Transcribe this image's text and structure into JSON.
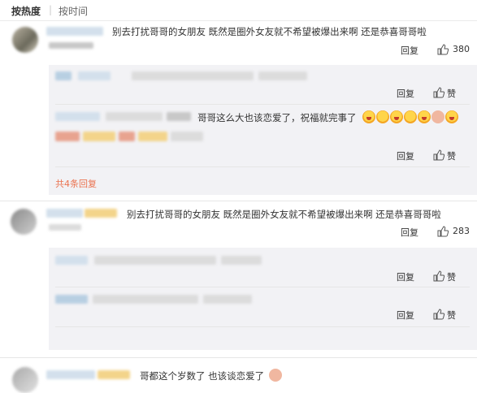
{
  "sort": {
    "hot_label": "按热度",
    "separator": "|",
    "time_label": "按时间"
  },
  "comments": [
    {
      "text": "别去打扰哥哥的女朋友 既然是圈外女友就不希望被爆出来啊 还是恭喜哥哥啦",
      "reply_label": "回复",
      "likes": "380",
      "replies": [
        {
          "reply_label": "回复",
          "like_label": "赞"
        },
        {
          "text": "哥哥这么大也该恋爱了，祝福就完事了",
          "reply_label": "回复",
          "like_label": "赞"
        }
      ],
      "more_replies": "共4条回复"
    },
    {
      "text": "别去打扰哥哥的女朋友 既然是圈外女友就不希望被爆出来啊 还是恭喜哥哥啦",
      "reply_label": "回复",
      "likes": "283",
      "replies": [
        {
          "reply_label": "回复",
          "like_label": "赞"
        },
        {
          "reply_label": "回复",
          "like_label": "赞"
        }
      ]
    },
    {
      "text": "哥都这个岁数了 也该谈恋爱了"
    }
  ],
  "colors": {
    "accent": "#eb7350",
    "reply_bg": "#f2f2f5",
    "text": "#333333"
  },
  "icons": {
    "like": "thumbs-up-icon",
    "emoji": "emoji-face-icon"
  }
}
